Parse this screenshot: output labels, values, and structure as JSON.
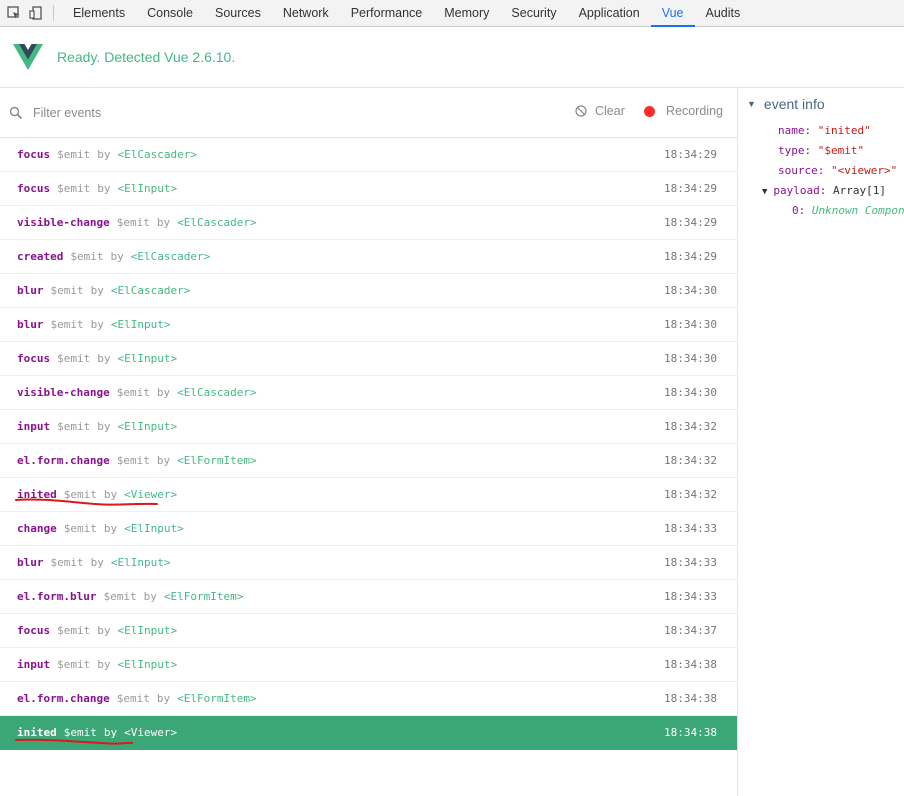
{
  "devtools": {
    "tabs": [
      "Elements",
      "Console",
      "Sources",
      "Network",
      "Performance",
      "Memory",
      "Security",
      "Application",
      "Vue",
      "Audits"
    ],
    "active_tab": "Vue",
    "icons": [
      "inspect-element-icon",
      "device-toolbar-icon"
    ]
  },
  "vue_header": {
    "status": "Ready. Detected Vue 2.6.10.",
    "logo": "vue-logo",
    "accent_color": "#42b983"
  },
  "filter": {
    "placeholder": "Filter events",
    "value": "",
    "clear_label": "Clear",
    "recording_label": "Recording",
    "recording_color": "#ff2b2b"
  },
  "events": [
    {
      "name": "focus",
      "emit": "$emit",
      "by": "by",
      "component": "<ElCascader>",
      "time": "18:34:29"
    },
    {
      "name": "focus",
      "emit": "$emit",
      "by": "by",
      "component": "<ElInput>",
      "time": "18:34:29"
    },
    {
      "name": "visible-change",
      "emit": "$emit",
      "by": "by",
      "component": "<ElCascader>",
      "time": "18:34:29"
    },
    {
      "name": "created",
      "emit": "$emit",
      "by": "by",
      "component": "<ElCascader>",
      "time": "18:34:29"
    },
    {
      "name": "blur",
      "emit": "$emit",
      "by": "by",
      "component": "<ElCascader>",
      "time": "18:34:30"
    },
    {
      "name": "blur",
      "emit": "$emit",
      "by": "by",
      "component": "<ElInput>",
      "time": "18:34:30"
    },
    {
      "name": "focus",
      "emit": "$emit",
      "by": "by",
      "component": "<ElInput>",
      "time": "18:34:30"
    },
    {
      "name": "visible-change",
      "emit": "$emit",
      "by": "by",
      "component": "<ElCascader>",
      "time": "18:34:30"
    },
    {
      "name": "input",
      "emit": "$emit",
      "by": "by",
      "component": "<ElInput>",
      "time": "18:34:32"
    },
    {
      "name": "el.form.change",
      "emit": "$emit",
      "by": "by",
      "component": "<ElFormItem>",
      "time": "18:34:32"
    },
    {
      "name": "inited",
      "emit": "$emit",
      "by": "by",
      "component": "<Viewer>",
      "time": "18:34:32"
    },
    {
      "name": "change",
      "emit": "$emit",
      "by": "by",
      "component": "<ElInput>",
      "time": "18:34:33"
    },
    {
      "name": "blur",
      "emit": "$emit",
      "by": "by",
      "component": "<ElInput>",
      "time": "18:34:33"
    },
    {
      "name": "el.form.blur",
      "emit": "$emit",
      "by": "by",
      "component": "<ElFormItem>",
      "time": "18:34:33"
    },
    {
      "name": "focus",
      "emit": "$emit",
      "by": "by",
      "component": "<ElInput>",
      "time": "18:34:37"
    },
    {
      "name": "input",
      "emit": "$emit",
      "by": "by",
      "component": "<ElInput>",
      "time": "18:34:38"
    },
    {
      "name": "el.form.change",
      "emit": "$emit",
      "by": "by",
      "component": "<ElFormItem>",
      "time": "18:34:38"
    },
    {
      "name": "inited",
      "emit": "$emit",
      "by": "by",
      "component": "<Viewer>",
      "time": "18:34:38"
    }
  ],
  "selected_event_index": 17,
  "selected_color": "#3ba776",
  "event_info": {
    "title": "event info",
    "name_key": "name:",
    "name_value": "\"inited\"",
    "type_key": "type:",
    "type_value": "\"$emit\"",
    "source_key": "source:",
    "source_value": "\"<viewer>\"",
    "payload_key": "payload:",
    "payload_value": "Array[1]",
    "payload_item_key": "0:",
    "payload_item_value": "Unknown Component"
  }
}
